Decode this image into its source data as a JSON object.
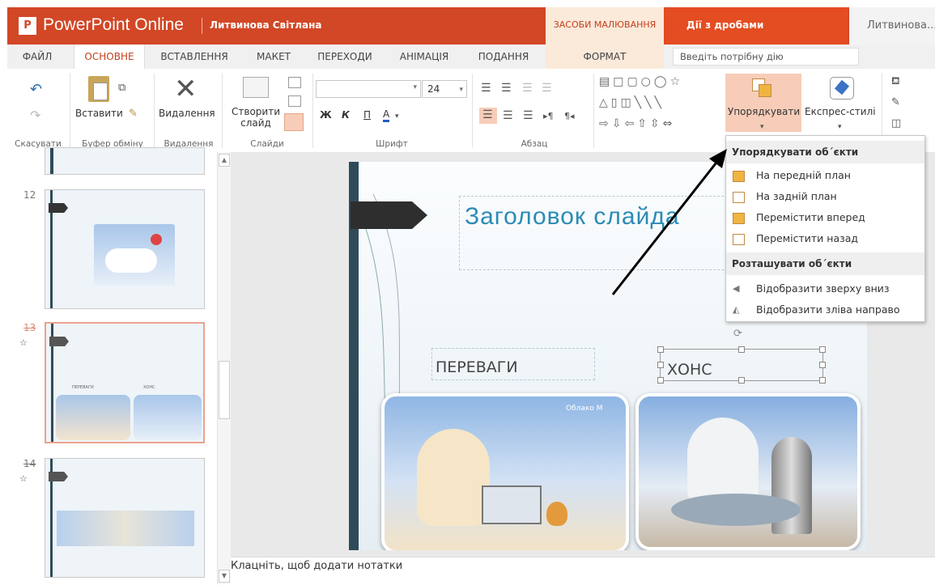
{
  "titlebar": {
    "app_logo": "P",
    "app_name": "PowerPoint Online",
    "user": "Литвинова Світлана",
    "context_tools": "ЗАСОБИ МАЛЮВАННЯ",
    "document_name": "Дії з дробами",
    "account_short": "Литвинова..."
  },
  "tabs": [
    "ФАЙЛ",
    "ОСНОВНЕ",
    "ВСТАВЛЕННЯ",
    "МАКЕТ",
    "ПЕРЕХОДИ",
    "АНІМАЦІЯ",
    "ПОДАННЯ",
    "ФОРМАТ"
  ],
  "tell_me": {
    "placeholder": "Введіть потрібну дію"
  },
  "ribbon": {
    "undo_group": "Скасувати",
    "paste_label": "Вставити",
    "clipboard_group": "Буфер обміну",
    "delete_label": "Видалення",
    "delete_group": "Видалення",
    "new_slide_line1": "Створити",
    "new_slide_line2": "слайд",
    "slides_group": "Слайди",
    "font_size": "24",
    "bold": "Ж",
    "italic": "К",
    "underline": "П",
    "font_color": "А",
    "font_group": "Шрифт",
    "paragraph_group": "Абзац",
    "arrange_label": "Упорядкувати",
    "quick_styles_label": "Експрес-стилі"
  },
  "arrange_menu": {
    "section1": "Упорядкувати об´єкти",
    "items1": [
      "На передній план",
      "На задній план",
      "Перемістити вперед",
      "Перемістити назад"
    ],
    "section2": "Розташувати об´єкти",
    "items2": [
      "Відобразити зверху вниз",
      "Відобразити зліва направо"
    ]
  },
  "thumbnails": {
    "slide12": "12",
    "slide13": "13",
    "slide14": "14",
    "t13_left": "ПЕРЕВАГИ",
    "t13_right": "ХОНС"
  },
  "slide": {
    "title": "Заголовок слайда",
    "left_label": "ПЕРЕВАГИ",
    "right_label": "ХОНС",
    "cloud_tag": "Облако М"
  },
  "notes": {
    "placeholder": "Клацніть, щоб додати нотатки"
  },
  "colors": {
    "accent": "#d24726",
    "context_tab": "#fbe9d9",
    "highlight": "#f7cdb9"
  }
}
